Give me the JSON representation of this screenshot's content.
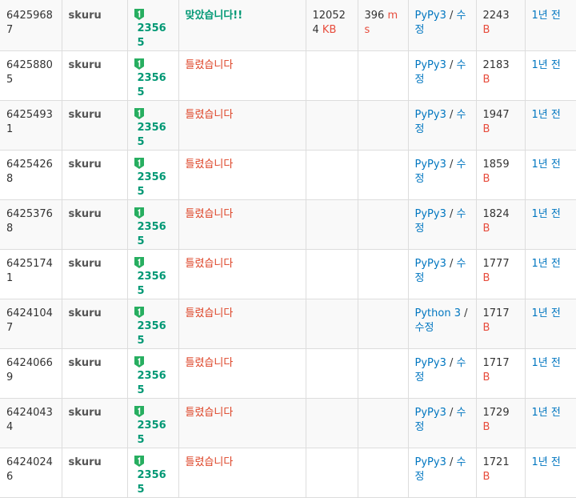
{
  "tier_icon_color": "#27ae60",
  "rows": [
    {
      "id": "64259687",
      "user": "skuru",
      "problem": "23565",
      "result": "맞았습니다!!",
      "result_ok": true,
      "memory": "120524",
      "memory_unit": "KB",
      "time": "396",
      "time_unit": "ms",
      "lang": "PyPy3",
      "sep": " / ",
      "edit": "수정",
      "length": "2243",
      "length_unit": "B",
      "date": "1년 전"
    },
    {
      "id": "64258805",
      "user": "skuru",
      "problem": "23565",
      "result": "틀렸습니다",
      "result_ok": false,
      "memory": "",
      "memory_unit": "",
      "time": "",
      "time_unit": "",
      "lang": "PyPy3",
      "sep": " / ",
      "edit": "수정",
      "length": "2183",
      "length_unit": "B",
      "date": "1년 전"
    },
    {
      "id": "64254931",
      "user": "skuru",
      "problem": "23565",
      "result": "틀렸습니다",
      "result_ok": false,
      "memory": "",
      "memory_unit": "",
      "time": "",
      "time_unit": "",
      "lang": "PyPy3",
      "sep": " / ",
      "edit": "수정",
      "length": "1947",
      "length_unit": "B",
      "date": "1년 전"
    },
    {
      "id": "64254268",
      "user": "skuru",
      "problem": "23565",
      "result": "틀렸습니다",
      "result_ok": false,
      "memory": "",
      "memory_unit": "",
      "time": "",
      "time_unit": "",
      "lang": "PyPy3",
      "sep": " / ",
      "edit": "수정",
      "length": "1859",
      "length_unit": "B",
      "date": "1년 전"
    },
    {
      "id": "64253768",
      "user": "skuru",
      "problem": "23565",
      "result": "틀렸습니다",
      "result_ok": false,
      "memory": "",
      "memory_unit": "",
      "time": "",
      "time_unit": "",
      "lang": "PyPy3",
      "sep": " / ",
      "edit": "수정",
      "length": "1824",
      "length_unit": "B",
      "date": "1년 전"
    },
    {
      "id": "64251741",
      "user": "skuru",
      "problem": "23565",
      "result": "틀렸습니다",
      "result_ok": false,
      "memory": "",
      "memory_unit": "",
      "time": "",
      "time_unit": "",
      "lang": "PyPy3",
      "sep": " / ",
      "edit": "수정",
      "length": "1777",
      "length_unit": "B",
      "date": "1년 전"
    },
    {
      "id": "64241047",
      "user": "skuru",
      "problem": "23565",
      "result": "틀렸습니다",
      "result_ok": false,
      "memory": "",
      "memory_unit": "",
      "time": "",
      "time_unit": "",
      "lang": "Python 3",
      "sep": " / ",
      "edit": "수정",
      "length": "1717",
      "length_unit": "B",
      "date": "1년 전"
    },
    {
      "id": "64240669",
      "user": "skuru",
      "problem": "23565",
      "result": "틀렸습니다",
      "result_ok": false,
      "memory": "",
      "memory_unit": "",
      "time": "",
      "time_unit": "",
      "lang": "PyPy3",
      "sep": " / ",
      "edit": "수정",
      "length": "1717",
      "length_unit": "B",
      "date": "1년 전"
    },
    {
      "id": "64240434",
      "user": "skuru",
      "problem": "23565",
      "result": "틀렸습니다",
      "result_ok": false,
      "memory": "",
      "memory_unit": "",
      "time": "",
      "time_unit": "",
      "lang": "PyPy3",
      "sep": " / ",
      "edit": "수정",
      "length": "1729",
      "length_unit": "B",
      "date": "1년 전"
    },
    {
      "id": "64240246",
      "user": "skuru",
      "problem": "23565",
      "result": "틀렸습니다",
      "result_ok": false,
      "memory": "",
      "memory_unit": "",
      "time": "",
      "time_unit": "",
      "lang": "PyPy3",
      "sep": " / ",
      "edit": "수정",
      "length": "1721",
      "length_unit": "B",
      "date": "1년 전"
    }
  ]
}
